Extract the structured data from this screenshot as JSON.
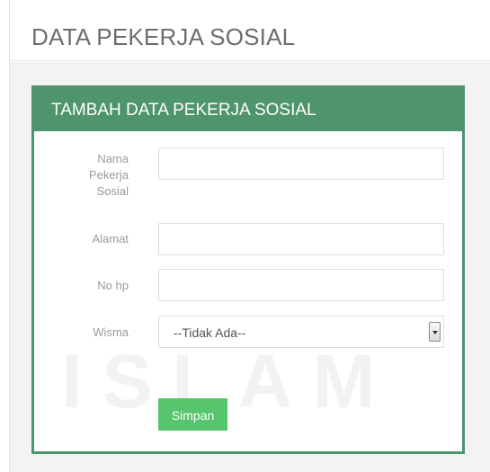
{
  "page": {
    "title": "DATA PEKERJA SOSIAL"
  },
  "panel": {
    "heading": "TAMBAH DATA PEKERJA SOSIAL",
    "watermark": "ISLAM"
  },
  "form": {
    "nama_label_lines": [
      "Nama",
      "Pekerja",
      "Sosial"
    ],
    "nama_value": "",
    "alamat_label": "Alamat",
    "alamat_value": "",
    "nohp_label": "No hp",
    "nohp_value": "",
    "wisma_label": "Wisma",
    "wisma_selected": "--Tidak Ada--",
    "submit_label": "Simpan"
  },
  "colors": {
    "panel_green": "#4e946c",
    "button_green": "#56c56b"
  }
}
